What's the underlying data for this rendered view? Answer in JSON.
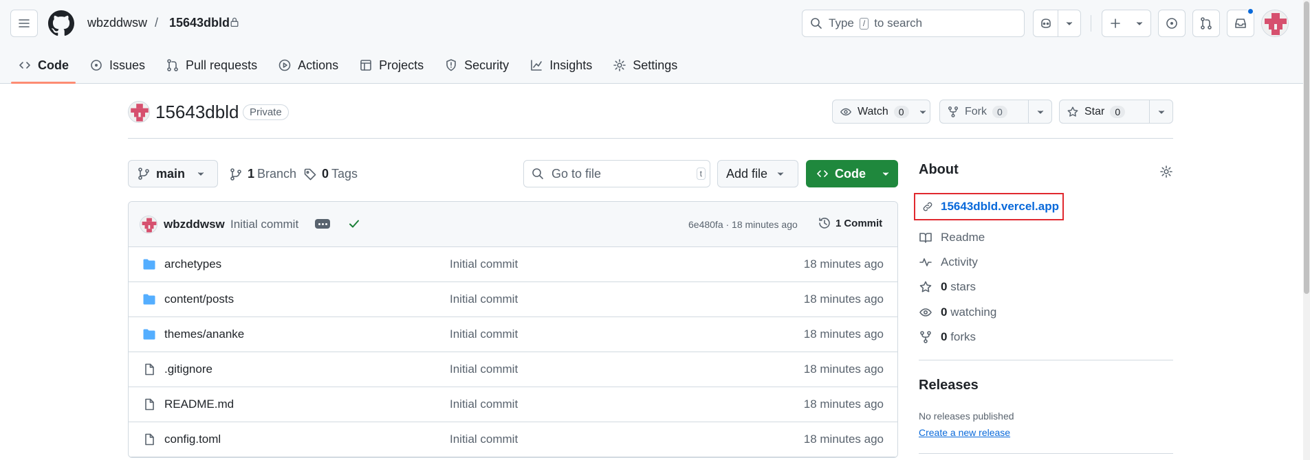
{
  "header": {
    "owner": "wbzddwsw",
    "separator": "/",
    "repo": "15643dbld",
    "search_prefix": "Type",
    "search_key": "/",
    "search_suffix": "to search"
  },
  "tabs": [
    {
      "label": "Code",
      "icon": "code-icon",
      "active": true
    },
    {
      "label": "Issues",
      "icon": "issue-icon"
    },
    {
      "label": "Pull requests",
      "icon": "pull-request-icon"
    },
    {
      "label": "Actions",
      "icon": "play-icon"
    },
    {
      "label": "Projects",
      "icon": "table-icon"
    },
    {
      "label": "Security",
      "icon": "shield-icon"
    },
    {
      "label": "Insights",
      "icon": "graph-icon"
    },
    {
      "label": "Settings",
      "icon": "gear-icon"
    }
  ],
  "repo": {
    "name": "15643dbld",
    "visibility": "Private",
    "watch_label": "Watch",
    "watch_count": "0",
    "fork_label": "Fork",
    "fork_count": "0",
    "star_label": "Star",
    "star_count": "0"
  },
  "branchbar": {
    "branch": "main",
    "branches_count": "1",
    "branches_label": "Branch",
    "tags_count": "0",
    "tags_label": "Tags",
    "goto_placeholder": "Go to file",
    "goto_key": "t",
    "addfile_label": "Add file",
    "code_label": "Code"
  },
  "commit": {
    "author": "wbzddwsw",
    "message": "Initial commit",
    "sha_time": "6e480fa · 18 minutes ago",
    "count": "1",
    "count_label": "Commit"
  },
  "files": [
    {
      "name": "archetypes",
      "type": "dir",
      "message": "Initial commit",
      "age": "18 minutes ago"
    },
    {
      "name": "content/posts",
      "type": "dir",
      "message": "Initial commit",
      "age": "18 minutes ago"
    },
    {
      "name": "themes/ananke",
      "type": "dir",
      "message": "Initial commit",
      "age": "18 minutes ago"
    },
    {
      "name": ".gitignore",
      "type": "file",
      "message": "Initial commit",
      "age": "18 minutes ago"
    },
    {
      "name": "README.md",
      "type": "file",
      "message": "Initial commit",
      "age": "18 minutes ago"
    },
    {
      "name": "config.toml",
      "type": "file",
      "message": "Initial commit",
      "age": "18 minutes ago"
    }
  ],
  "about": {
    "title": "About",
    "homepage": "15643dbld.vercel.app",
    "readme": "Readme",
    "activity": "Activity",
    "stars_count": "0",
    "stars_label": "stars",
    "watching_count": "0",
    "watching_label": "watching",
    "forks_count": "0",
    "forks_label": "forks"
  },
  "releases": {
    "title": "Releases",
    "empty_text": "No releases published",
    "create_link": "Create a new release"
  },
  "colors": {
    "accent_link": "#0969da",
    "primary_button": "#1f883d",
    "active_tab_underline": "#fd8c73",
    "highlight_box": "#e0282e",
    "folder": "#54aeff"
  }
}
